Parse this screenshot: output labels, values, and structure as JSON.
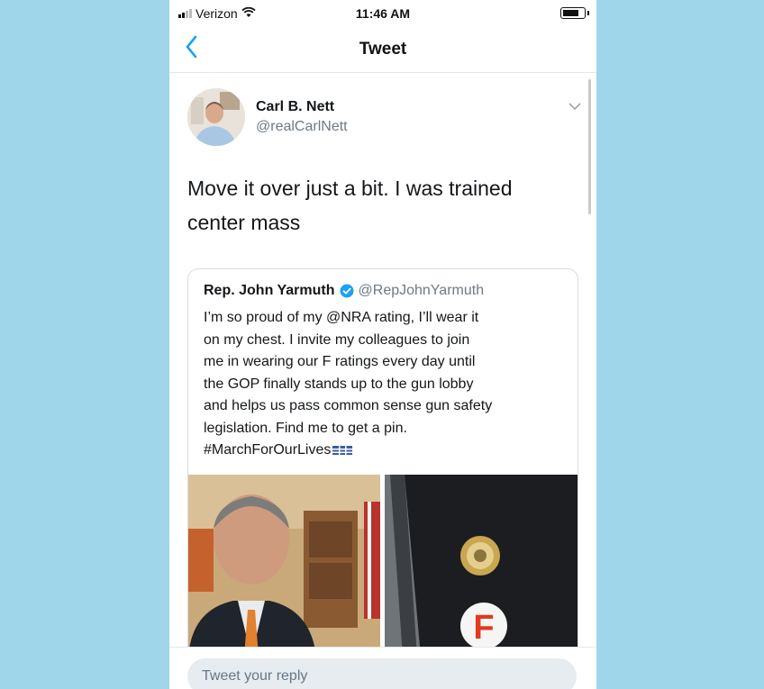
{
  "status_bar": {
    "carrier": "Verizon",
    "time": "11:46 AM"
  },
  "nav": {
    "title": "Tweet",
    "back_icon": "chevron-left-icon"
  },
  "tweet": {
    "author_name": "Carl B. Nett",
    "author_handle": "@realCarlNett",
    "text_line1": "Move it over just a bit. I was trained",
    "text_line2": "center mass"
  },
  "quoted_tweet": {
    "author_name": "Rep. John Yarmuth",
    "author_handle": "@RepJohnYarmuth",
    "verified": true,
    "lines": [
      "I’m so proud of my @NRA rating, I’ll wear it",
      "on my chest. I invite my colleagues to join",
      "me in wearing our F ratings every day until",
      "the GOP finally stands up to the gun lobby",
      "and helps us pass common sense gun safety",
      "legislation. Find me to get a pin.",
      "#MarchForOurLives"
    ],
    "photos": [
      "man-in-suit-photo",
      "lapel-pins-photo"
    ],
    "pin_letter": "F"
  },
  "reply": {
    "placeholder": "Tweet your reply"
  },
  "colors": {
    "background": "#9fd6ea",
    "accent": "#1da1f2",
    "pin_red": "#e23a1f"
  }
}
